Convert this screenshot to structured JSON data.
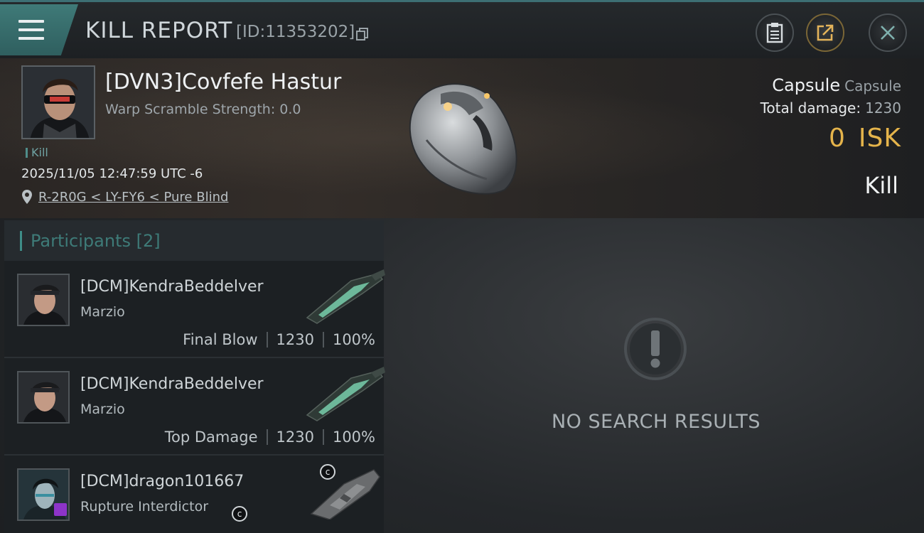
{
  "header": {
    "title": "KILL REPORT",
    "report_id": "[ID:11353202]",
    "icons": [
      "menu-icon",
      "copy-icon",
      "clipboard-icon",
      "share-icon",
      "close-icon"
    ]
  },
  "victim": {
    "name": "[DVN3]Covfefe Hastur",
    "warp_scramble": "Warp Scramble Strength: 0.0",
    "tag": "Kill",
    "timestamp": "2025/11/05 12:47:59 UTC -6",
    "location": "R-2R0G < LY-FY6 < Pure Blind",
    "ship_type": "Capsule",
    "ship_class": "Capsule",
    "total_damage_label": "Total damage:",
    "total_damage_value": "1230",
    "isk_value": "0",
    "isk_currency": "ISK",
    "result": "Kill"
  },
  "participants": {
    "label": "Participants",
    "count": "[2]",
    "rows": [
      {
        "name": "[DCM]KendraBeddelver",
        "ship": "Marzio",
        "role": "Final Blow",
        "damage": "1230",
        "percent": "100%"
      },
      {
        "name": "[DCM]KendraBeddelver",
        "ship": "Marzio",
        "role": "Top Damage",
        "damage": "1230",
        "percent": "100%"
      },
      {
        "name": "[DCM]dragon101667",
        "ship": "Rupture Interdictor"
      }
    ]
  },
  "results": {
    "empty_text": "NO SEARCH RESULTS"
  },
  "colors": {
    "accent_teal": "#3e8d88",
    "isk_gold": "#e5b44b",
    "purple_badge": "#8d34c9"
  }
}
